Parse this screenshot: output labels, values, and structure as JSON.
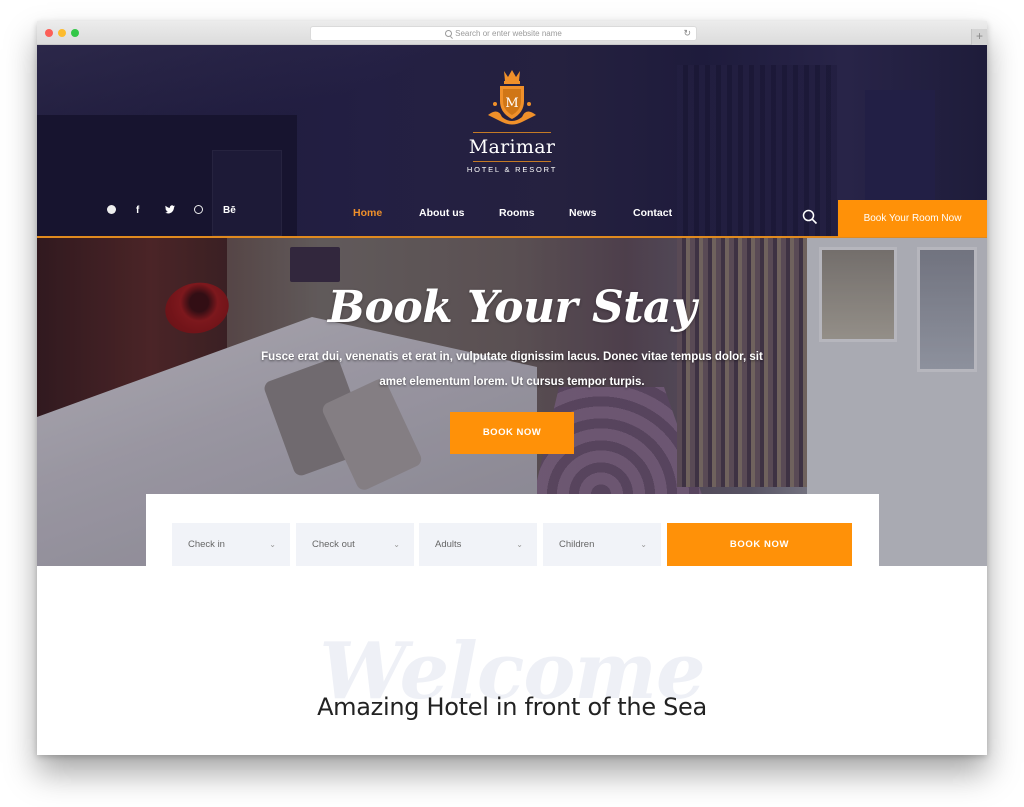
{
  "browser": {
    "url_placeholder": "Search or enter website name",
    "reload_icon": "↻",
    "newtab_icon": "+"
  },
  "brand": {
    "name": "Marimar",
    "tagline": "HOTEL & RESORT",
    "monogram": "M",
    "accent_color": "#ff9108"
  },
  "social": [
    {
      "icon": "pinterest-icon",
      "glyph": ""
    },
    {
      "icon": "facebook-icon",
      "glyph": "f"
    },
    {
      "icon": "twitter-icon",
      "glyph": "🐦"
    },
    {
      "icon": "dribbble-icon",
      "glyph": ""
    },
    {
      "icon": "behance-icon",
      "glyph": "Bē"
    }
  ],
  "nav": {
    "items": [
      {
        "label": "Home",
        "active": true
      },
      {
        "label": "About us",
        "active": false
      },
      {
        "label": "Rooms",
        "active": false
      },
      {
        "label": "News",
        "active": false
      },
      {
        "label": "Contact",
        "active": false
      }
    ],
    "cta": "Book Your Room Now"
  },
  "hero": {
    "title": "Book Your Stay",
    "description": "Fusce erat dui, venenatis et erat in, vulputate dignissim lacus. Donec vitae tempus dolor, sit amet elementum lorem. Ut cursus tempor turpis.",
    "button": "BOOK NOW"
  },
  "booking": {
    "fields": [
      {
        "label": "Check in"
      },
      {
        "label": "Check out"
      },
      {
        "label": "Adults"
      },
      {
        "label": "Children"
      }
    ],
    "chevron": "⌄",
    "button": "BOOK NOW"
  },
  "welcome": {
    "background_word": "Welcome",
    "title": "Amazing Hotel in front of the Sea"
  }
}
